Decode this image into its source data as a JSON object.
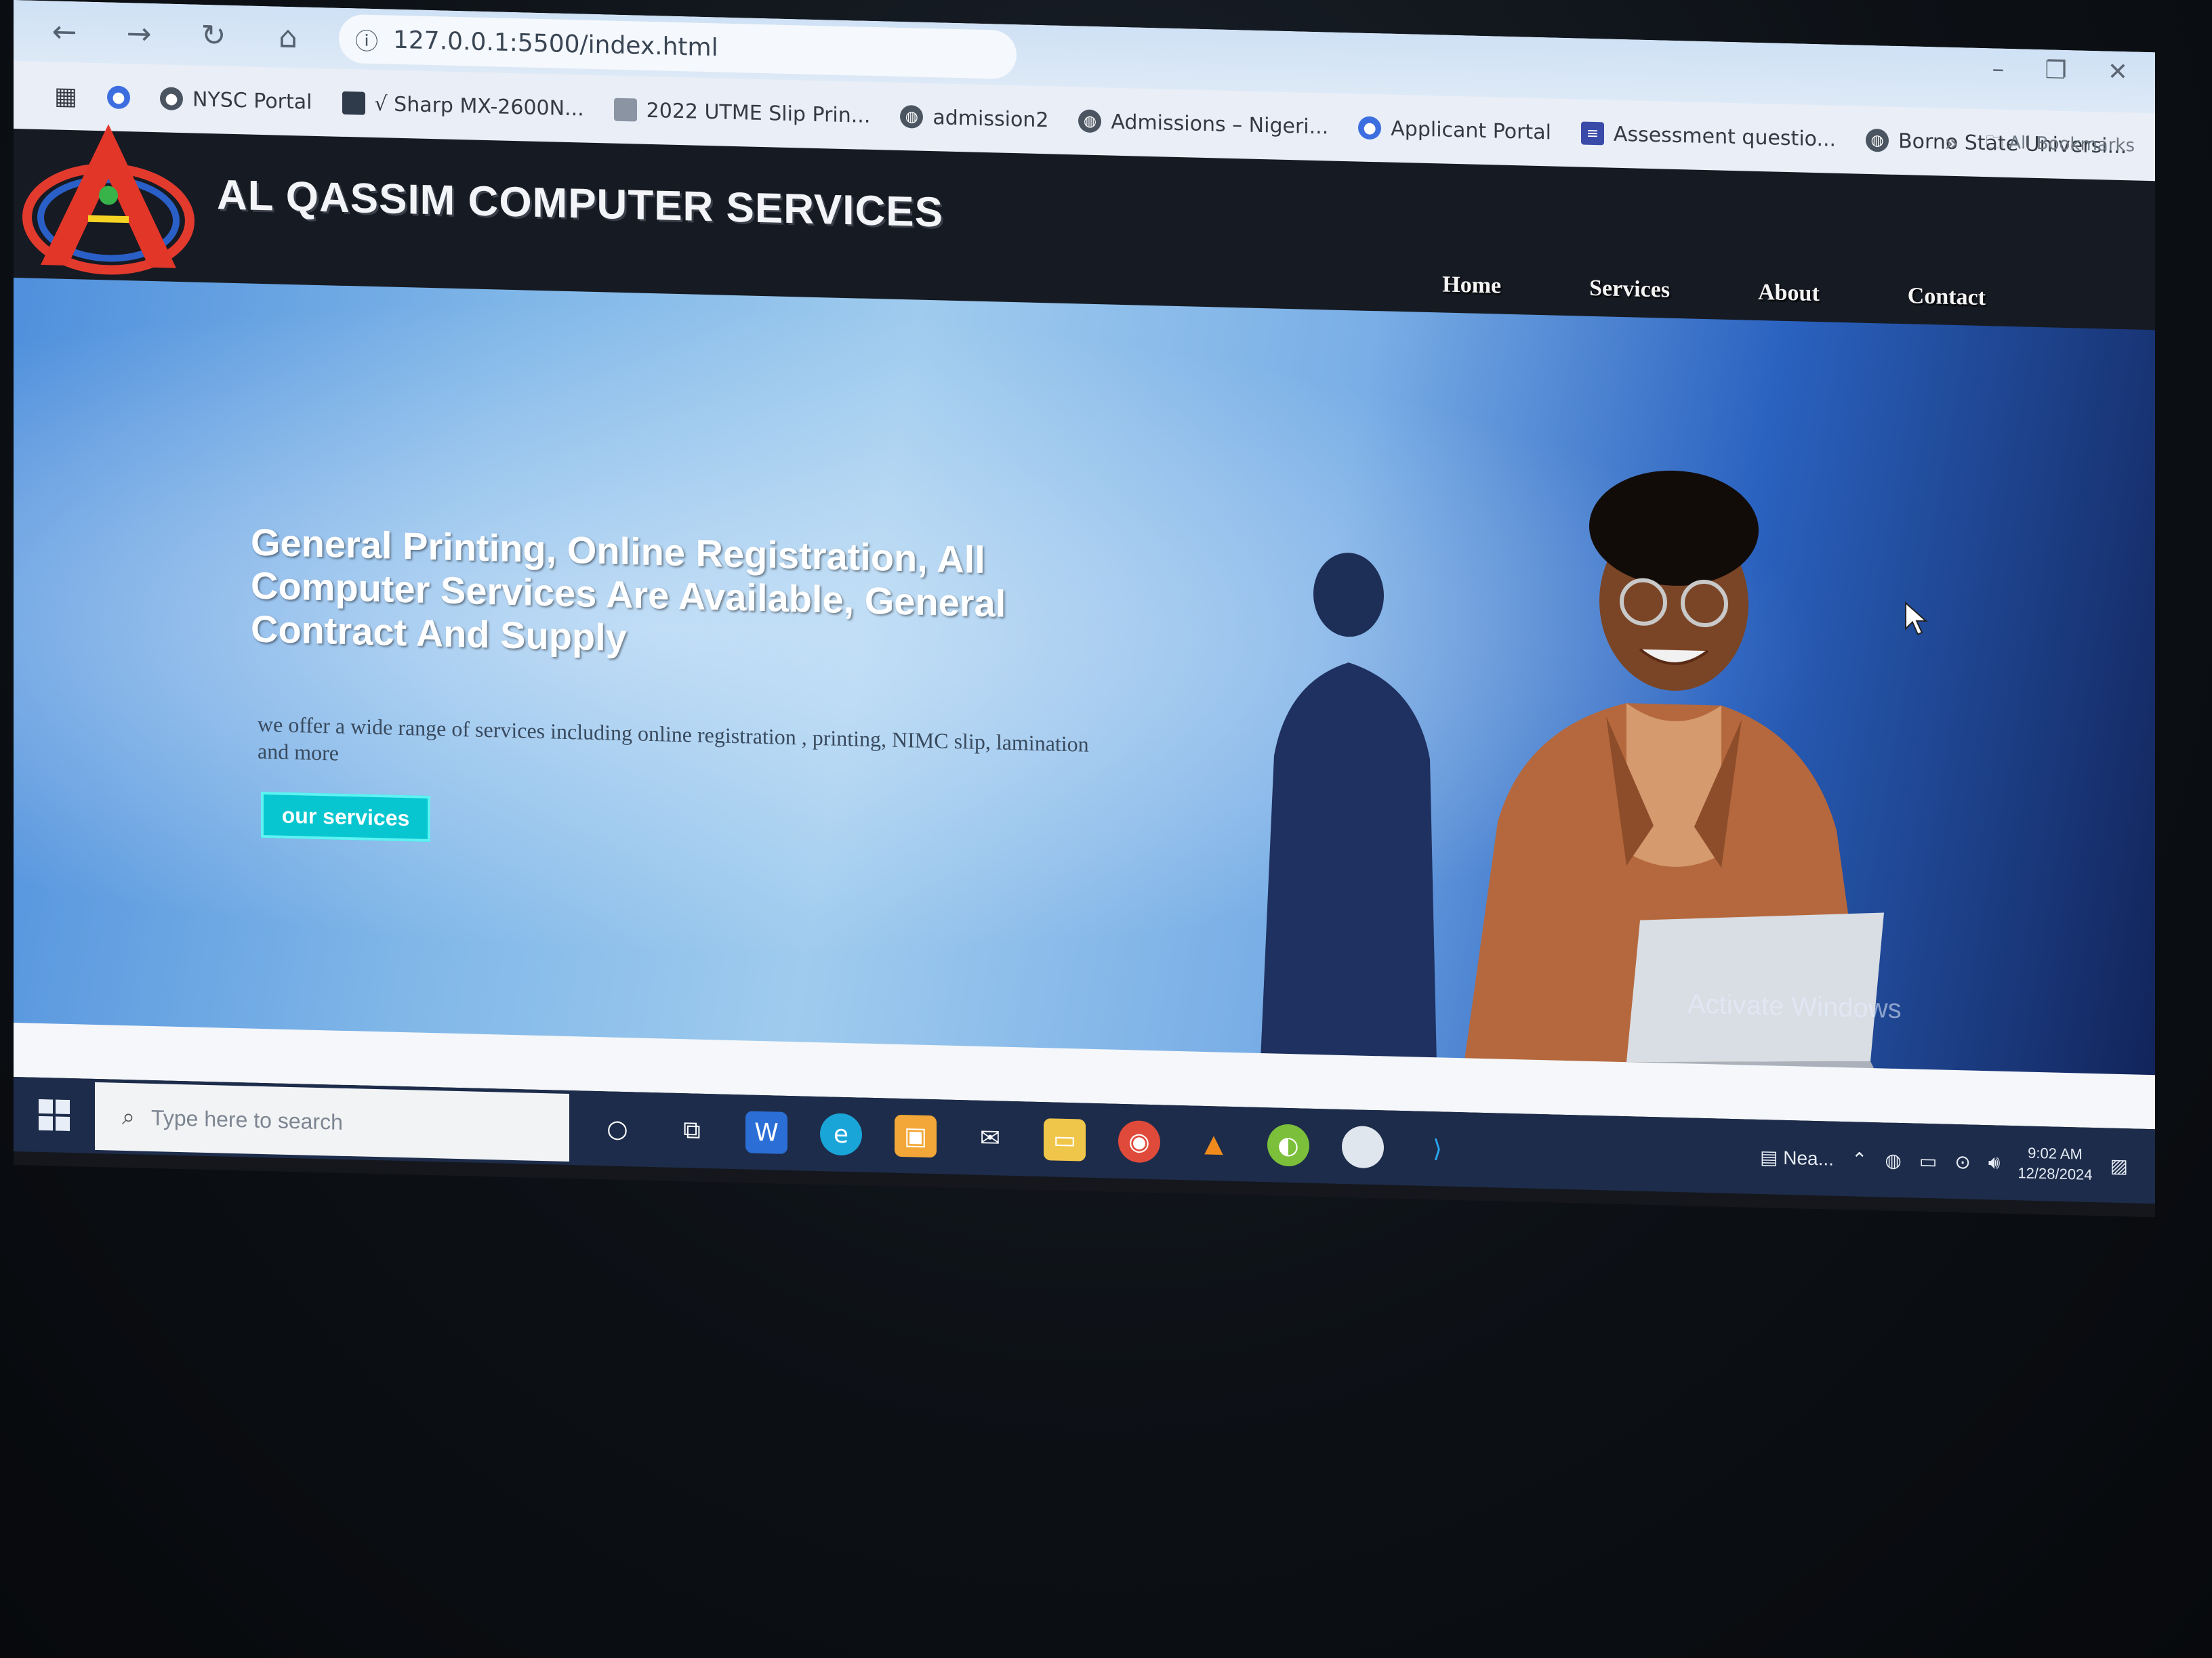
{
  "browser": {
    "url": "127.0.0.1:5500/index.html",
    "bookmarks": [
      {
        "label": "NYSC Portal",
        "icon": "nysc-icon"
      },
      {
        "label": "√ Sharp MX-2600N...",
        "icon": "sharp-icon"
      },
      {
        "label": "2022 UTME Slip Prin...",
        "icon": "document-icon"
      },
      {
        "label": "admission2",
        "icon": "globe-icon"
      },
      {
        "label": "Admissions – Nigeri...",
        "icon": "globe-icon"
      },
      {
        "label": "Applicant Portal",
        "icon": "portal-icon"
      },
      {
        "label": "Assessment questio...",
        "icon": "sheet-icon"
      },
      {
        "label": "Borno State Universi...",
        "icon": "globe-icon"
      }
    ],
    "more_bookmarks": "»",
    "all_bookmarks": "All Bookmarks"
  },
  "site": {
    "title": "AL QASSIM COMPUTER SERVICES",
    "nav": [
      "Home",
      "Services",
      "About",
      "Contact"
    ],
    "hero": {
      "heading": "General Printing, Online Registration, All Computer Services Are Available, General Contract And Supply",
      "subtext": "we offer a wide range of services including online registration , printing, NIMC slip, lamination and more",
      "button": "our services"
    },
    "watermark": "Activate Windows"
  },
  "taskbar": {
    "search_placeholder": "Type here to search",
    "weather": "Nea...",
    "time": "9:02 AM",
    "date": "12/28/2024"
  },
  "colors": {
    "header_bg": "#161a22",
    "button_accent": "#08c6cf",
    "taskbar_bg": "#1d2c4a"
  }
}
